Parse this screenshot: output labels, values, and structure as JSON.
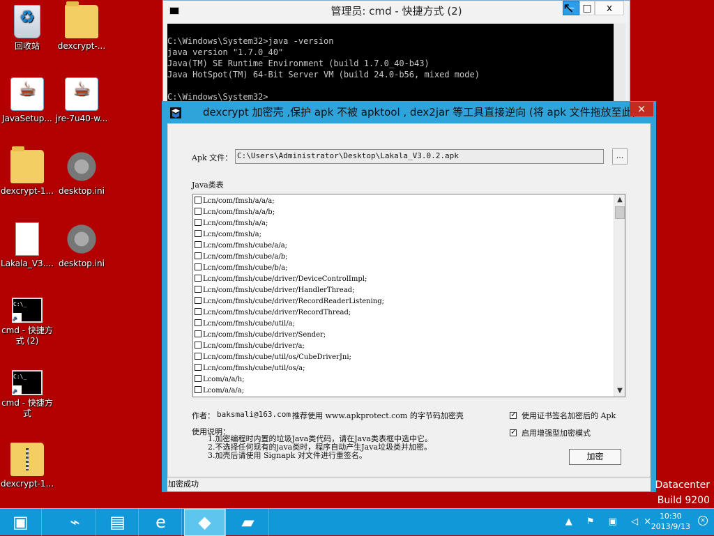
{
  "desktop": {
    "icons": [
      {
        "label": "回收站",
        "icon": "recycle-bin-icon"
      },
      {
        "label": "dexcrypt-...",
        "icon": "folder-icon"
      },
      {
        "label": "JavaSetup...",
        "icon": "java-installer-icon"
      },
      {
        "label": "jre-7u40-w...",
        "icon": "java-installer-icon"
      },
      {
        "label": "dexcrypt-1...",
        "icon": "folder-icon"
      },
      {
        "label": "desktop.ini",
        "icon": "gear-file-icon"
      },
      {
        "label": "Lakala_V3....",
        "icon": "file-icon"
      },
      {
        "label": "desktop.ini",
        "icon": "gear-file-icon"
      },
      {
        "label": "cmd - 快捷方式 (2)",
        "icon": "cmd-shortcut-icon"
      },
      {
        "label": "cmd - 快捷方式",
        "icon": "cmd-shortcut-icon"
      },
      {
        "label": "dexcrypt-1...",
        "icon": "zip-folder-icon"
      }
    ]
  },
  "cmd_window": {
    "title": "管理员: cmd - 快捷方式 (2)",
    "console_text": "C:\\Windows\\System32>java -version\njava version \"1.7.0_40\"\nJava(TM) SE Runtime Environment (build 1.7.0_40-b43)\nJava HotSpot(TM) 64-Bit Server VM (build 24.0-b56, mixed mode)\n\nC:\\Windows\\System32>",
    "close_glyph": "x"
  },
  "app_window": {
    "title": "dexcrypt 加密壳 ,保护 apk 不被 apktool , dex2jar 等工具直接逆向 (将 apk 文件拖放至此)",
    "apk_label": "Apk 文件：",
    "apk_path": "C:\\Users\\Administrator\\Desktop\\Lakala_V3.0.2.apk",
    "browse_label": "...",
    "java_classes_label": "Java类表",
    "classes": [
      "Lcn/com/fmsh/a/a/a;",
      "Lcn/com/fmsh/a/a/b;",
      "Lcn/com/fmsh/a/a;",
      "Lcn/com/fmsh/a;",
      "Lcn/com/fmsh/cube/a/a;",
      "Lcn/com/fmsh/cube/a/b;",
      "Lcn/com/fmsh/cube/b/a;",
      "Lcn/com/fmsh/cube/driver/DeviceControlImpl;",
      "Lcn/com/fmsh/cube/driver/HandlerThread;",
      "Lcn/com/fmsh/cube/driver/RecordReaderListening;",
      "Lcn/com/fmsh/cube/driver/RecordThread;",
      "Lcn/com/fmsh/cube/util/a;",
      "Lcn/com/fmsh/cube/driver/Sender;",
      "Lcn/com/fmsh/cube/driver/a;",
      "Lcn/com/fmsh/cube/util/os/CubeDriverJni;",
      "Lcn/com/fmsh/cube/util/os/a;",
      "Lcom/a/a/h;",
      "Lcom/a/a/a;"
    ],
    "author_label": "作者：",
    "author_email": "baksmali@163.com",
    "recommendation": "推荐使用 www.apkprotect.com 的字节码加密壳",
    "option_cert": "使用证书签名加密后的 Apk",
    "option_enhanced": "启用增强型加密模式",
    "usage_title": "使用说明：",
    "usage": [
      "1.加密编程时内置的垃圾Java类代码，请在Java类表框中选中它。",
      "2.不选择任何现有的java类时，程序自动产生Java垃圾类并加密。",
      "3.加壳后请使用 Signapk 对文件进行重签名。"
    ],
    "encrypt_button": "加密",
    "status": "加密成功"
  },
  "os_watermark": {
    "line1": "Datacenter",
    "line2": "Build 9200"
  },
  "taskbar": {
    "time": "10:30",
    "date": "2013/9/13",
    "tray_icons": "▲ ⚑ ▣ ◁×",
    "notify_glyph": "×"
  }
}
